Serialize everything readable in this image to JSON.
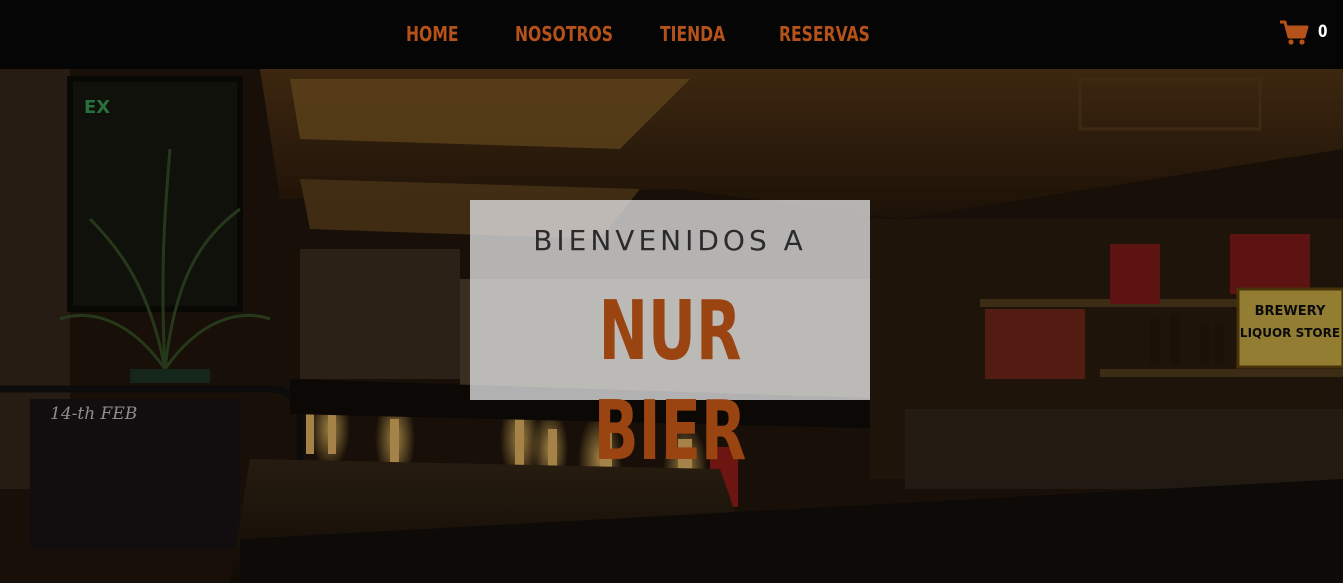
{
  "nav": {
    "items": [
      {
        "label": "HOME"
      },
      {
        "label": "NOSOTROS"
      },
      {
        "label": "TIENDA"
      },
      {
        "label": "RESERVAS"
      }
    ],
    "cart": {
      "icon": "cart-icon",
      "count": "0"
    }
  },
  "hero": {
    "welcome_text": "BIENVENIDOS A",
    "brand_name": "NUR BIER",
    "scene_signs": {
      "exit": "EX",
      "brewery": "BREWERY",
      "liquor_store": "LIQUOR STORE",
      "chalkboard": "14-th FEB"
    }
  },
  "colors": {
    "accent": "#b4521a",
    "brand": "#9a4411",
    "nav_bg": "#050505",
    "panel_bg": "#e1e1e1"
  }
}
